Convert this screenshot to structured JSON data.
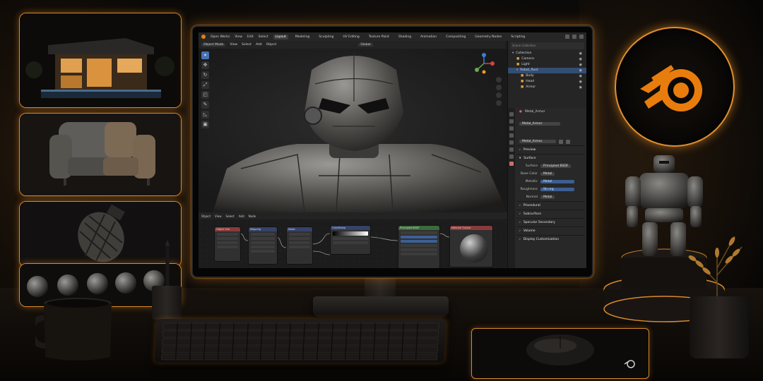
{
  "brand": {
    "accent": "#E87D0D",
    "glow": "#D8892A",
    "selection": "#4772B3"
  },
  "window": {
    "menu": [
      "Open Works",
      "View",
      "Edit",
      "Select"
    ],
    "workspaces": [
      "Layout",
      "Modeling",
      "Sculpting",
      "UV Editing",
      "Texture Paint",
      "Shading",
      "Animation",
      "Compositing",
      "Geometry Nodes",
      "Scripting"
    ],
    "active_workspace": "Layout"
  },
  "viewport": {
    "mode": "Object Mode",
    "menus": [
      "View",
      "Select",
      "Add",
      "Object"
    ],
    "shading_label": "Global"
  },
  "toolbar_icons": [
    "cursor-icon",
    "move-icon",
    "rotate-icon",
    "scale-icon",
    "transform-icon",
    "annotate-icon",
    "measure-icon",
    "add-cube-icon"
  ],
  "outliner": {
    "search_placeholder": "Scene Collection",
    "items": [
      {
        "label": "Collection",
        "indent": 0,
        "selected": false
      },
      {
        "label": "Camera",
        "indent": 1,
        "selected": false
      },
      {
        "label": "Light",
        "indent": 1,
        "selected": false
      },
      {
        "label": "Robot_Rust",
        "indent": 1,
        "selected": true
      },
      {
        "label": "Body",
        "indent": 2,
        "selected": false
      },
      {
        "label": "Head",
        "indent": 2,
        "selected": false
      },
      {
        "label": "Armor",
        "indent": 2,
        "selected": false
      }
    ]
  },
  "properties": {
    "material_slot": "Metal_Armor",
    "material_name": "Metal_Armor",
    "datablock": "Metal_Armor",
    "sections": [
      "Preview",
      "Surface"
    ],
    "surface_label": "Surface",
    "surface_value": "Principled BSDF",
    "fields": [
      {
        "label": "Base Color",
        "value": "Metal",
        "blue": false
      },
      {
        "label": "Metallic",
        "value": "Metal",
        "blue": true
      },
      {
        "label": "Roughness",
        "value": "Sh nrg",
        "blue": true
      },
      {
        "label": "Normal",
        "value": "Metal",
        "blue": false
      }
    ],
    "collapsed_sections": [
      "Procedural",
      "Subsurface",
      "Specular Secondary",
      "Volume",
      "Display Customization"
    ]
  },
  "node_editor": {
    "header": [
      "Object",
      "View",
      "Select",
      "Add",
      "Node"
    ],
    "nodes": [
      {
        "title": "Object Info",
        "color": "#8a3a3a"
      },
      {
        "title": "Mapping",
        "color": "#35426b"
      },
      {
        "title": "Noise",
        "color": "#35426b"
      },
      {
        "title": "ColorRamp",
        "color": "#35426b"
      },
      {
        "title": "Principled BSDF",
        "color": "#3b6a3b"
      },
      {
        "title": "Material Output",
        "color": "#8a3a3a"
      }
    ]
  },
  "icons": {
    "logo": "blender-logo-icon",
    "mousepad_logo": "blender-logo-small-icon"
  }
}
